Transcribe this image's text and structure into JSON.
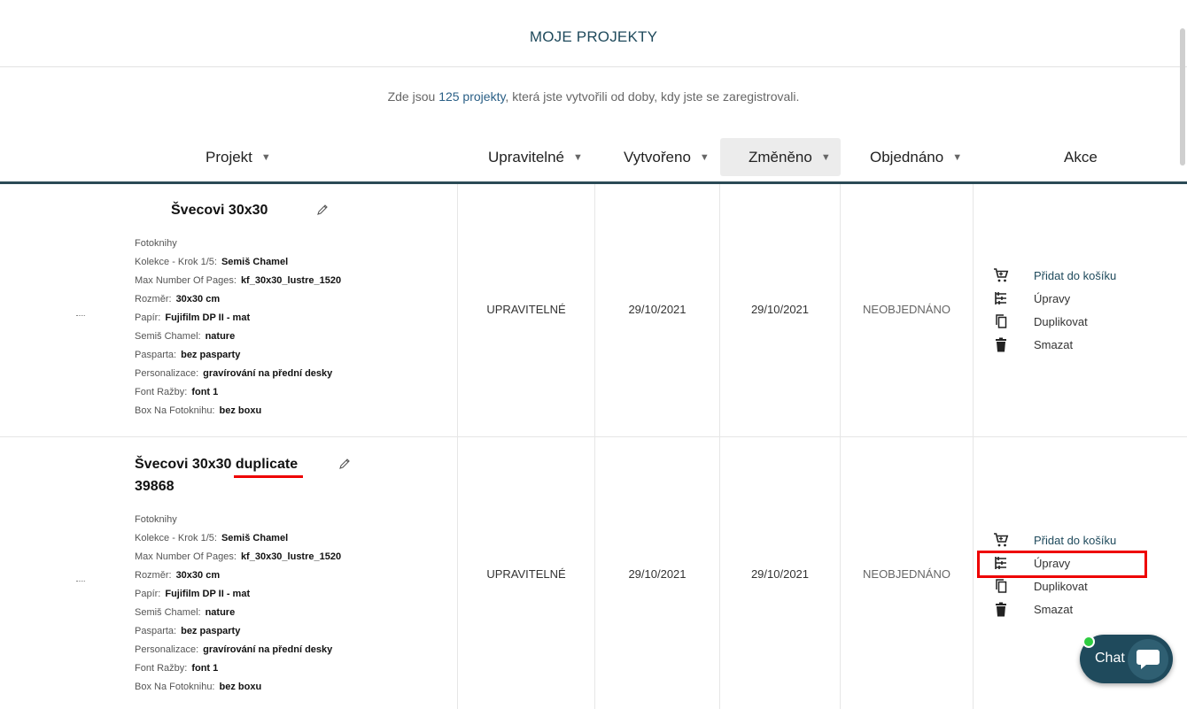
{
  "header": {
    "title": "MOJE PROJEKTY"
  },
  "intro": {
    "before": "Zde jsou ",
    "link": "125 projekty",
    "after": ", která jste vytvořili od doby, kdy jste se zaregistrovali."
  },
  "columns": {
    "project": "Projekt",
    "editable": "Upravitelné",
    "created": "Vytvořeno",
    "modified": "Změněno",
    "ordered": "Objednáno",
    "actions": "Akce",
    "sort_glyph": "▼"
  },
  "rows": [
    {
      "name": "Švecovi 30x30",
      "category": "Fotoknihy",
      "props": [
        {
          "k": "Kolekce - Krok 1/5:",
          "v": "Semiš Chamel"
        },
        {
          "k": "Max Number Of Pages:",
          "v": "kf_30x30_lustre_1520"
        },
        {
          "k": "Rozměr:",
          "v": "30x30 cm"
        },
        {
          "k": "Papír:",
          "v": "Fujifilm DP II - mat"
        },
        {
          "k": "Semiš Chamel:",
          "v": "nature"
        },
        {
          "k": "Pasparta:",
          "v": "bez pasparty"
        },
        {
          "k": "Personalizace:",
          "v": "gravírování na přední desky"
        },
        {
          "k": "Font Ražby:",
          "v": "font 1"
        },
        {
          "k": "Box Na Fotoknihu:",
          "v": "bez boxu"
        }
      ],
      "editable": "UPRAVITELNÉ",
      "created": "29/10/2021",
      "modified": "29/10/2021",
      "ordered": "NEOBJEDNÁNO"
    },
    {
      "name_a": "Švecovi 30x30 ",
      "name_b": "duplicate",
      "name_c": "39868",
      "category": "Fotoknihy",
      "props": [
        {
          "k": "Kolekce - Krok 1/5:",
          "v": "Semiš Chamel"
        },
        {
          "k": "Max Number Of Pages:",
          "v": "kf_30x30_lustre_1520"
        },
        {
          "k": "Rozměr:",
          "v": "30x30 cm"
        },
        {
          "k": "Papír:",
          "v": "Fujifilm DP II - mat"
        },
        {
          "k": "Semiš Chamel:",
          "v": "nature"
        },
        {
          "k": "Pasparta:",
          "v": "bez pasparty"
        },
        {
          "k": "Personalizace:",
          "v": "gravírování na přední desky"
        },
        {
          "k": "Font Ražby:",
          "v": "font 1"
        },
        {
          "k": "Box Na Fotoknihu:",
          "v": "bez boxu"
        }
      ],
      "editable": "UPRAVITELNÉ",
      "created": "29/10/2021",
      "modified": "29/10/2021",
      "ordered": "NEOBJEDNÁNO"
    }
  ],
  "actions": {
    "add_to_cart": "Přidat do košíku",
    "edit": "Úpravy",
    "duplicate": "Duplikovat",
    "delete": "Smazat"
  },
  "icons": {
    "cart": "cart-icon",
    "edit": "edit-list-icon",
    "duplicate": "copy-icon",
    "delete": "trash-icon",
    "rename": "pencil-icon",
    "chat": "chat-bubble-icon"
  },
  "chat": {
    "label": "Chat"
  },
  "colors": {
    "brand": "#1f4a5c",
    "highlight": "#e00000",
    "online": "#2ecc40"
  }
}
